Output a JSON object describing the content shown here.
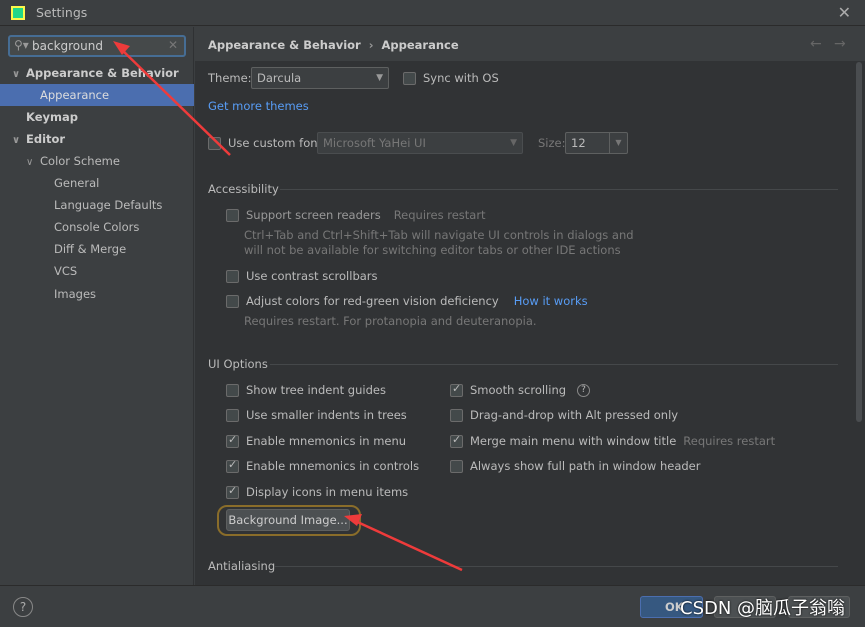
{
  "window": {
    "title": "Settings",
    "logo": "PC"
  },
  "search": {
    "value": "background"
  },
  "tree": [
    {
      "label": "Appearance & Behavior",
      "expanded": true,
      "bold": true
    },
    {
      "label": "Appearance",
      "selected": true
    },
    {
      "label": "Keymap",
      "bold": true
    },
    {
      "label": "Editor",
      "expanded": true,
      "bold": true
    },
    {
      "label": "Color Scheme",
      "expanded": true
    },
    {
      "label": "General"
    },
    {
      "label": "Language Defaults"
    },
    {
      "label": "Console Colors"
    },
    {
      "label": "Diff & Merge"
    },
    {
      "label": "VCS"
    },
    {
      "label": "Images"
    }
  ],
  "breadcrumb": {
    "parent": "Appearance & Behavior",
    "sep": "›",
    "current": "Appearance"
  },
  "theme": {
    "label": "Theme:",
    "value": "Darcula",
    "sync_label": "Sync with OS",
    "get_more": "Get more themes"
  },
  "font": {
    "label": "Use custom font:",
    "value": "Microsoft YaHei UI",
    "size_label": "Size:",
    "size": "12"
  },
  "accessibility": {
    "title": "Accessibility",
    "screen_readers": "Support screen readers",
    "requires_restart": "Requires restart",
    "screen_readers_note1": "Ctrl+Tab and Ctrl+Shift+Tab will navigate UI controls in dialogs and",
    "screen_readers_note2": "will not be available for switching editor tabs or other IDE actions",
    "contrast": "Use contrast scrollbars",
    "red_green": "Adjust colors for red-green vision deficiency",
    "how_it_works": "How it works",
    "red_green_note": "Requires restart. For protanopia and deuteranopia."
  },
  "ui_options": {
    "title": "UI Options",
    "left": [
      {
        "label": "Show tree indent guides",
        "checked": false
      },
      {
        "label": "Use smaller indents in trees",
        "checked": false
      },
      {
        "label": "Enable mnemonics in menu",
        "checked": true
      },
      {
        "label": "Enable mnemonics in controls",
        "checked": true
      },
      {
        "label": "Display icons in menu items",
        "checked": true
      }
    ],
    "right": [
      {
        "label": "Smooth scrolling",
        "checked": true,
        "help": "?"
      },
      {
        "label": "Drag-and-drop with Alt pressed only",
        "checked": false
      },
      {
        "label": "Merge main menu with window title",
        "checked": true,
        "note": "Requires restart"
      },
      {
        "label": "Always show full path in window header",
        "checked": false
      }
    ],
    "background_image": "Background Image..."
  },
  "antialiasing": {
    "title": "Antialiasing"
  },
  "footer": {
    "help": "?",
    "ok": "OK",
    "watermark": "CSDN @脑瓜子翁嗡"
  }
}
